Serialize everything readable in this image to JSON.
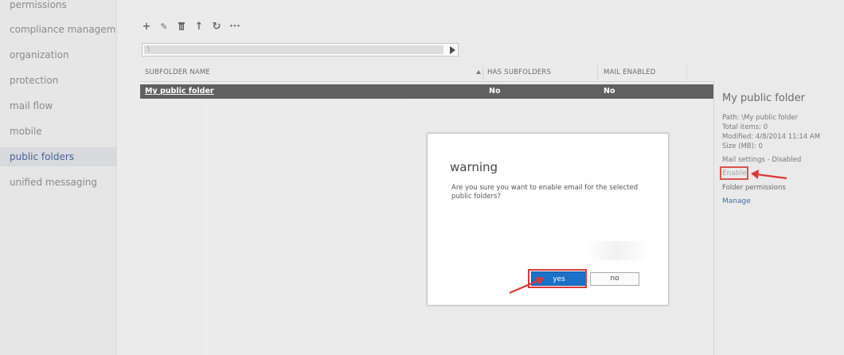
{
  "nav": {
    "items": [
      {
        "label": "permissions",
        "active": false
      },
      {
        "label": "compliance management",
        "active": false
      },
      {
        "label": "organization",
        "active": false
      },
      {
        "label": "protection",
        "active": false
      },
      {
        "label": "mail flow",
        "active": false
      },
      {
        "label": "mobile",
        "active": false
      },
      {
        "label": "public folders",
        "active": true
      },
      {
        "label": "unified messaging",
        "active": false
      }
    ]
  },
  "toolbar": {
    "icons": [
      "add-icon",
      "edit-icon",
      "delete-icon",
      "up-arrow-icon",
      "refresh-icon",
      "more-icon"
    ],
    "glyphs": [
      "+",
      "✎",
      "🗑",
      "↑",
      "↻",
      "•••"
    ]
  },
  "path": {
    "value": "\\"
  },
  "table": {
    "columns": [
      "SUBFOLDER NAME",
      "HAS SUBFOLDERS",
      "MAIL ENABLED"
    ],
    "rows": [
      {
        "name": "My public folder",
        "has_subfolders": "No",
        "mail_enabled": "No"
      }
    ]
  },
  "details": {
    "title": "My public folder",
    "path": "Path: \\My public folder",
    "total_items": "Total items: 0",
    "modified": "Modified: 4/8/2014 11:14 AM",
    "size": "Size (MB): 0",
    "mail_settings": "Mail settings - Disabled",
    "enable_link": "Enable",
    "folder_permissions": "Folder permissions",
    "manage_link": "Manage"
  },
  "dialog": {
    "title": "warning",
    "message": "Are you sure you want to enable email for the selected public folders?",
    "yes_label": "yes",
    "no_label": "no"
  },
  "colors": {
    "accent": "#1b70c8",
    "annotation": "#d9393a",
    "selected_row": "#4a4a4a",
    "link": "#2a5a9a"
  }
}
